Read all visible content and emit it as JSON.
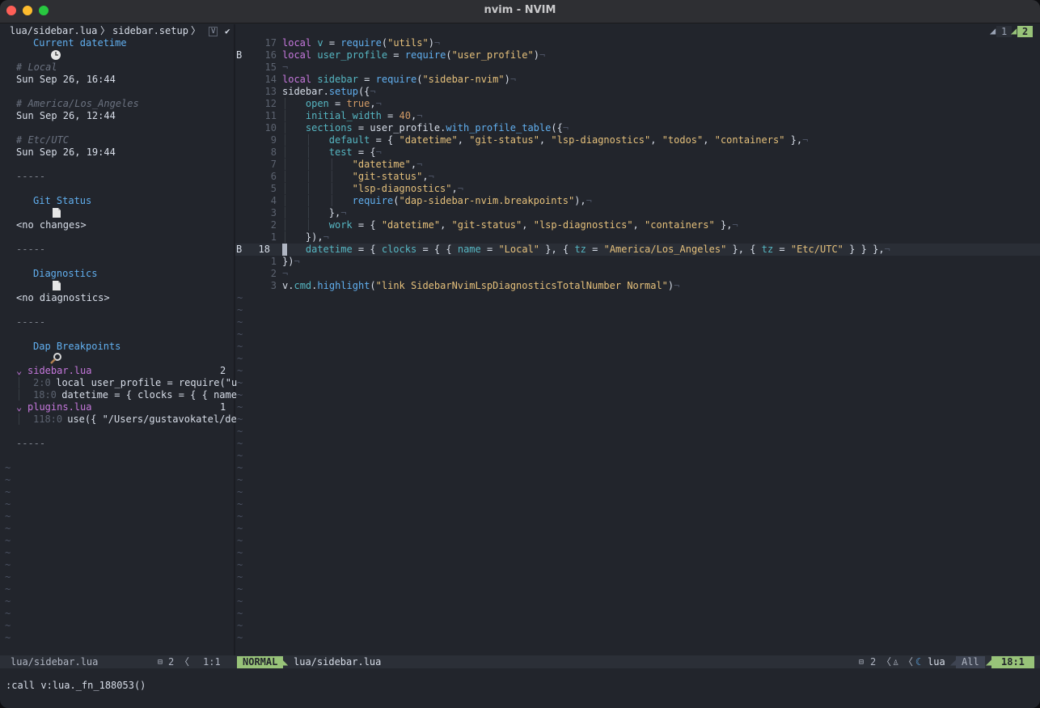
{
  "window": {
    "title": "nvim - NVIM"
  },
  "winbar": {
    "file": "lua/sidebar.lua",
    "sep": "〉",
    "symbol": "sidebar.setup",
    "badge": "V",
    "check": "✔"
  },
  "tabs": {
    "tab1": "1",
    "tab2": "2"
  },
  "sidebar": {
    "datetime_title": "Current datetime",
    "tz_local_label": "# Local",
    "tz_local_time": "Sun Sep 26, 16:44",
    "tz_la_label": "# America/Los_Angeles",
    "tz_la_time": "Sun Sep 26, 12:44",
    "tz_utc_label": "# Etc/UTC",
    "tz_utc_time": "Sun Sep 26, 19:44",
    "divider": "-----",
    "git_title": "Git Status",
    "git_body": "<no changes>",
    "diag_title": "Diagnostics",
    "diag_body": "<no diagnostics>",
    "dap_title": "Dap Breakpoints",
    "bp_file1": "sidebar.lua",
    "bp_file1_count": "2",
    "bp1_loc": "2:0",
    "bp1_text": " local user_profile = require(\"u",
    "bp2_loc": "18:0",
    "bp2_text": " datetime = { clocks = { { name",
    "bp_file2": "plugins.lua",
    "bp_file2_count": "1",
    "bp3_loc": "118:0",
    "bp3_text": " use({ \"/Users/gustavokatel/de"
  },
  "editor": {
    "lines": [
      {
        "sign": "",
        "ln": "17",
        "code": "local v = require(\"utils\")"
      },
      {
        "sign": "B",
        "ln": "16",
        "code": "local user_profile = require(\"user_profile\")"
      },
      {
        "sign": "",
        "ln": "15",
        "code": ""
      },
      {
        "sign": "",
        "ln": "14",
        "code": "local sidebar = require(\"sidebar-nvim\")"
      },
      {
        "sign": "",
        "ln": "13",
        "code": "sidebar.setup({"
      },
      {
        "sign": "",
        "ln": "12",
        "code": "open = true,"
      },
      {
        "sign": "",
        "ln": "11",
        "code": "initial_width = 40,"
      },
      {
        "sign": "",
        "ln": "10",
        "code": "sections = user_profile.with_profile_table({"
      },
      {
        "sign": "",
        "ln": "9",
        "code": "default = { \"datetime\", \"git-status\", \"lsp-diagnostics\", \"todos\", \"containers\" },"
      },
      {
        "sign": "",
        "ln": "8",
        "code": "test = {"
      },
      {
        "sign": "",
        "ln": "7",
        "code": "\"datetime\","
      },
      {
        "sign": "",
        "ln": "6",
        "code": "\"git-status\","
      },
      {
        "sign": "",
        "ln": "5",
        "code": "\"lsp-diagnostics\","
      },
      {
        "sign": "",
        "ln": "4",
        "code": "require(\"dap-sidebar-nvim.breakpoints\"),"
      },
      {
        "sign": "",
        "ln": "3",
        "code": "},"
      },
      {
        "sign": "",
        "ln": "2",
        "code": "work = { \"datetime\", \"git-status\", \"lsp-diagnostics\", \"containers\" },"
      },
      {
        "sign": "",
        "ln": "1",
        "code": "}),"
      },
      {
        "sign": "B",
        "ln": "18",
        "code": "datetime = { clocks = { { name = \"Local\" }, { tz = \"America/Los_Angeles\" }, { tz = \"Etc/UTC\" } } },"
      },
      {
        "sign": "",
        "ln": "1",
        "code": "})"
      },
      {
        "sign": "",
        "ln": "2",
        "code": ""
      },
      {
        "sign": "",
        "ln": "3",
        "code": "v.cmd.highlight(\"link SidebarNvimLspDiagnosticsTotalNumber Normal\")"
      }
    ],
    "eol": "¬",
    "tilde": "~"
  },
  "statusbar": {
    "left_file": "lua/sidebar.lua",
    "left_buf": "2",
    "left_pos": "1:1",
    "mode": "NORMAL",
    "file": "lua/sidebar.lua",
    "buf": "2",
    "filetype": "lua",
    "scroll": "All",
    "pos": "18:1"
  },
  "cmdline": {
    "text": ":call v:lua._fn_188053()"
  },
  "colors": {
    "accent_green": "#98c379",
    "accent_blue": "#61afef",
    "accent_purple": "#c678dd",
    "string": "#e5c07b"
  }
}
